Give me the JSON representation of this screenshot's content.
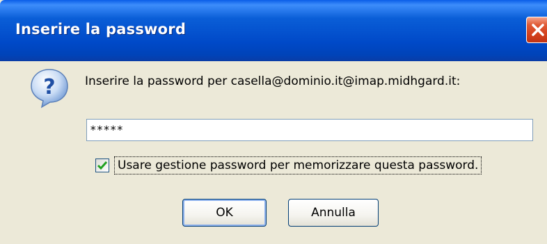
{
  "window": {
    "title": "Inserire la password"
  },
  "dialog": {
    "prompt": "Inserire la password per casella@dominio.it@imap.midhgard.it:",
    "password_value": "*****",
    "remember_label": "Usare gestione password per memorizzare questa password.",
    "remember_checked": true,
    "ok_label": "OK",
    "cancel_label": "Annulla"
  },
  "colors": {
    "titlebar": "#0054e3",
    "close_button": "#d2401c",
    "dialog_bg": "#ece9d8",
    "checkmark": "#21a121"
  },
  "icons": {
    "question": "question-icon",
    "close": "close-icon",
    "check": "checkmark-icon"
  }
}
